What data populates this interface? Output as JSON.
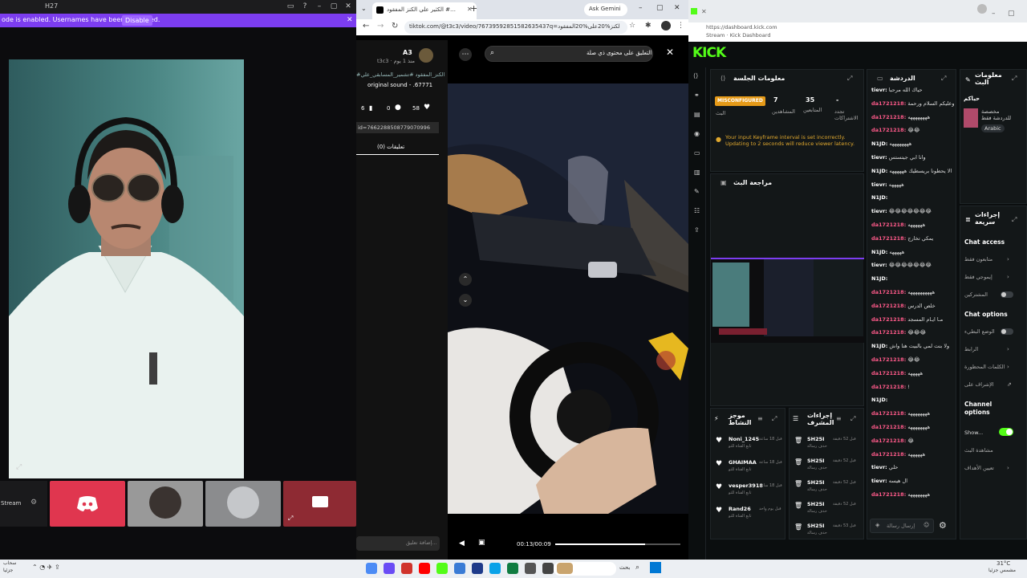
{
  "left": {
    "title": "H27",
    "banner_text": "ode is enabled. Usernames have been truncated.",
    "banner_button": "Disable",
    "stream_label": "Stream"
  },
  "mid": {
    "tab_title": "الكثير علي الكنز المفقود #…",
    "new_tab": "+",
    "gemini_label": "Ask Gemini",
    "url": "tiktok.com/@t3c3/video/76739592851582635437q=الكنز%20على%20المفقود&t=17868…",
    "search_text": "التعليق على محتوى ذي صلة",
    "username": "A3",
    "handle": "t3c3 · منذ 1 يوم",
    "hashtags": "#الكنز_المفقود #تشمير_المسابقي_علي …",
    "sound": "original sound - .67771",
    "likes": "6",
    "comments_count": "0",
    "shares": "58",
    "vid_id": "id=7662288508779070996",
    "comments_tab": "تعليقات (0)",
    "comment_placeholder": "إضافة تعليق...",
    "time": "00:13/00:09",
    "progress": 0.72
  },
  "right": {
    "url": "https://dashboard.kick.com",
    "page_title": "Stream · Kick Dashboard",
    "logo": "KICK",
    "session_title": "معلومات الجلسة",
    "misconfigured": "MISCONFIGURED",
    "stat_viewers_val": "7",
    "stat_viewers_label": "المشاهدين",
    "stat_followers_val": "35",
    "stat_followers_label": "المتابعين",
    "stat_subs_val": "-",
    "stat_subs_label": "تجدد الاشتراكات",
    "live_label": "البث",
    "warning": "Your input Keyframe interval is set incorrectly. Updating to 2 seconds will reduce viewer latency.",
    "preview_title": "مراجعة البث",
    "chat_title": "الدردشة",
    "mod_actions_title": "إجراءات المشرف",
    "recent_followers_title": "موجز النشاط",
    "stream_info_title": "معلومات البث",
    "stream_info_text": "مخصصة للدردشة فقط",
    "language": "Arabic",
    "hello": "حياكم",
    "quick_actions": "إجراءات سريعة",
    "chat_access": "Chat access",
    "chat_options": "Chat options",
    "channel_options": "Channel options",
    "show_label": "Show...",
    "opt_followers": "متابعون فقط",
    "opt_emotes": "إيموجي فقط",
    "opt_subs": "المشتركين",
    "opt_slow": "الوضع البطيء",
    "opt_block": "الرابط",
    "opt_banned": "الكلمات المحظورة",
    "opt_mod": "الإشراف على",
    "opt_watch": "مشاهدة البث",
    "opt_goals": "تعيين الأهداف",
    "chat_input": "إرسال رسالة",
    "chat": [
      {
        "u": "tievr:",
        "m": "حياك الله مرحبا"
      },
      {
        "u": "da1721218:",
        "m": "وعليكم السلام ورحمة"
      },
      {
        "u": "da1721218:",
        "m": "ههههههههه"
      },
      {
        "u": "da1721218:",
        "m": "😂😂"
      },
      {
        "u": "N1JD:",
        "m": "ههههههههه"
      },
      {
        "u": "tievr:",
        "m": "وانا ابي جيتستس"
      },
      {
        "u": "N1JD:",
        "m": "الا يحطونا بريسطيك ههههههه"
      },
      {
        "u": "tievr:",
        "m": "هههههه"
      },
      {
        "u": "N1JD:",
        "m": ""
      },
      {
        "u": "tievr:",
        "m": "😂😂😂😂😂😂😂"
      },
      {
        "u": "da1721218:",
        "m": "ههههههه"
      },
      {
        "u": "da1721218:",
        "m": "يمكي تخارج"
      },
      {
        "u": "N1JD:",
        "m": "هههههه"
      },
      {
        "u": "tievr:",
        "m": "😂😂😂😂😂😂😂"
      },
      {
        "u": "N1JD:",
        "m": ""
      },
      {
        "u": "da1721218:",
        "m": "ههههههههههه"
      },
      {
        "u": "da1721218:",
        "m": "خلص الدرس"
      },
      {
        "u": "da1721218:",
        "m": "مـا ايـام المسجد"
      },
      {
        "u": "da1721218:",
        "m": "😂😂😂"
      },
      {
        "u": "N1JD:",
        "m": "ولا بنت لمي بالبيت هنا واش"
      },
      {
        "u": "da1721218:",
        "m": "😂😂"
      },
      {
        "u": "da1721218:",
        "m": "هههههه"
      },
      {
        "u": "da1721218:",
        "m": "!"
      },
      {
        "u": "N1JD:",
        "m": ""
      },
      {
        "u": "da1721218:",
        "m": "ههههههههه"
      },
      {
        "u": "da1721218:",
        "m": "ههههههههه"
      },
      {
        "u": "da1721218:",
        "m": "😂"
      },
      {
        "u": "da1721218:",
        "m": "ههههههه"
      },
      {
        "u": "tievr:",
        "m": "حلي"
      },
      {
        "u": "tievr:",
        "m": "ال هيسه"
      },
      {
        "u": "da1721218:",
        "m": "ههههههههه"
      }
    ],
    "followers": [
      {
        "name": "Noni_1245",
        "time": "قبل 18 ساعة",
        "sub": "تابع القناة للتو"
      },
      {
        "name": "GHAIMAA",
        "time": "قبل 18 ساعة",
        "sub": "تابع القناة للتو"
      },
      {
        "name": "vesper3918",
        "time": "قبل 18 ساعة",
        "sub": "تابع القناة للتو"
      },
      {
        "name": "Rand26",
        "time": "قبل يوم واحد",
        "sub": "تابع القناة للتو"
      }
    ],
    "mod_actions": [
      {
        "name": "SH25I",
        "time": "قبل 52 دقيقة",
        "sub": "حذف رسالة"
      },
      {
        "name": "SH25I",
        "time": "قبل 52 دقيقة",
        "sub": "حذف رسالة"
      },
      {
        "name": "SH25I",
        "time": "قبل 52 دقيقة",
        "sub": "حذف رسالة"
      },
      {
        "name": "SH25I",
        "time": "قبل 52 دقيقة",
        "sub": "حذف رسالة"
      },
      {
        "name": "SH25I",
        "time": "قبل 53 دقيقة",
        "sub": "حذف رسالة"
      }
    ]
  },
  "taskbar": {
    "left_text": "سحاب",
    "left_sub": "جزئيا",
    "search": "بحث",
    "weather": "31°C",
    "weather_sub": "مشمس جزئيا"
  },
  "colors": {
    "kick_green": "#53fc18",
    "banner_purple": "#7c3df0",
    "discord": "#e0364f",
    "warning": "#e0a82e"
  }
}
